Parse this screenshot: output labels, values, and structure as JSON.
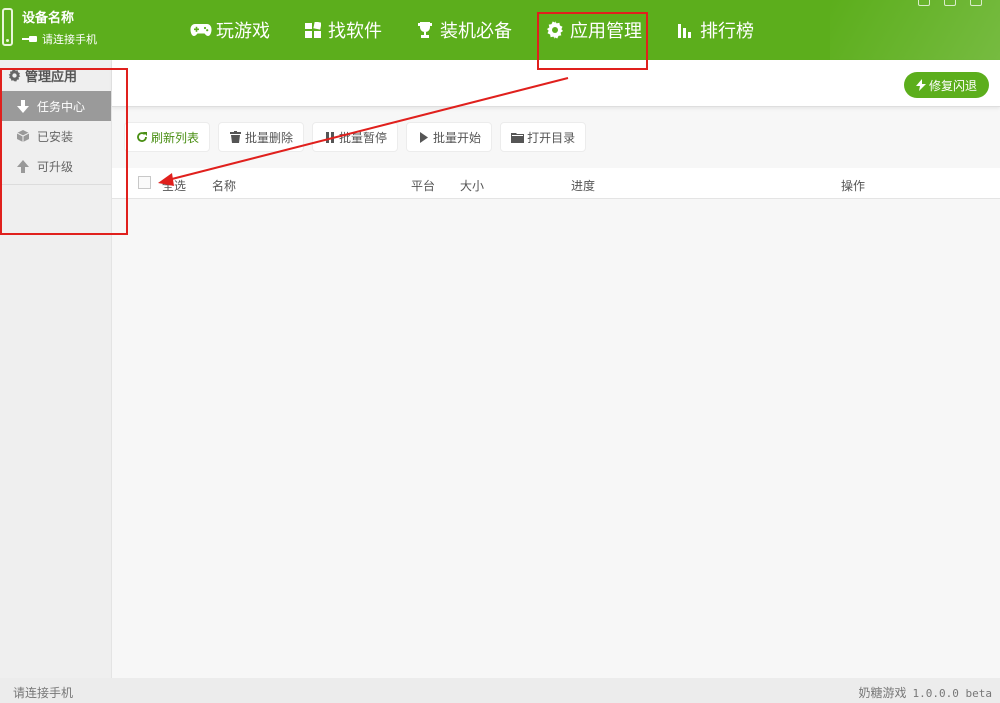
{
  "device": {
    "name": "设备名称",
    "status": "请连接手机"
  },
  "nav": {
    "items": [
      {
        "label": "玩游戏",
        "icon": "gamepad-icon"
      },
      {
        "label": "找软件",
        "icon": "apps-grid-icon"
      },
      {
        "label": "装机必备",
        "icon": "trophy-icon"
      },
      {
        "label": "应用管理",
        "icon": "gear-icon",
        "active": true
      },
      {
        "label": "排行榜",
        "icon": "bar-chart-icon"
      }
    ]
  },
  "sidebar": {
    "title": "管理应用",
    "items": [
      {
        "label": "任务中心",
        "icon": "download-arrow-icon",
        "active": true
      },
      {
        "label": "已安装",
        "icon": "cube-icon"
      },
      {
        "label": "可升级",
        "icon": "up-arrow-icon"
      }
    ]
  },
  "header_right": {
    "repair_label": "修复闪退"
  },
  "toolbar": {
    "refresh": "刷新列表",
    "batch_delete": "批量删除",
    "batch_pause": "批量暂停",
    "batch_start": "批量开始",
    "open_dir": "打开目录"
  },
  "table": {
    "select_all": "全选",
    "columns": [
      "名称",
      "平台",
      "大小",
      "进度",
      "操作"
    ]
  },
  "statusbar": {
    "left": "请连接手机",
    "app_name": "奶糖游戏",
    "version": "1.0.0.0 beta"
  },
  "colors": {
    "brand_green": "#5cae1c",
    "annotation_red": "#e0201d"
  }
}
